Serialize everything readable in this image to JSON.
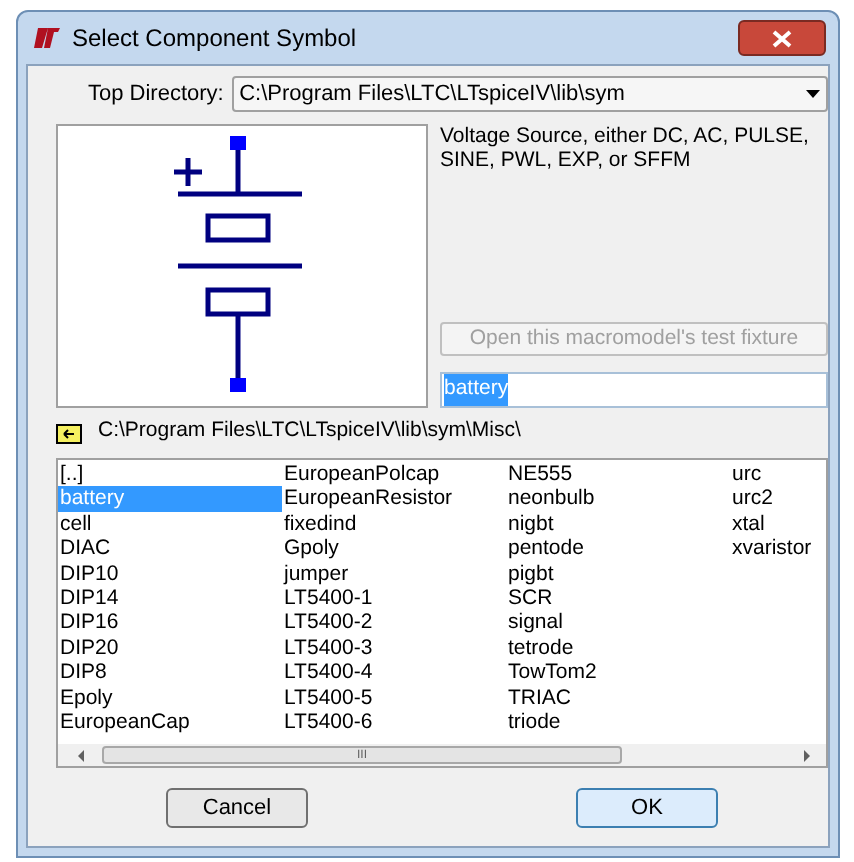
{
  "window": {
    "title": "Select Component Symbol"
  },
  "top_directory": {
    "label": "Top Directory:",
    "value": "C:\\Program Files\\LTC\\LTspiceIV\\lib\\sym"
  },
  "description": "Voltage Source, either DC, AC, PULSE, SINE, PWL, EXP, or SFFM",
  "test_fixture_button": {
    "label": "Open this macromodel's test fixture",
    "disabled": true
  },
  "name_field": {
    "value": "battery",
    "highlighted": true
  },
  "current_path": "C:\\Program Files\\LTC\\LTspiceIV\\lib\\sym\\Misc\\",
  "file_columns": [
    [
      {
        "name": "[..]",
        "selected": false
      },
      {
        "name": "battery",
        "selected": true
      },
      {
        "name": "cell",
        "selected": false
      },
      {
        "name": "DIAC",
        "selected": false
      },
      {
        "name": "DIP10",
        "selected": false
      },
      {
        "name": "DIP14",
        "selected": false
      },
      {
        "name": "DIP16",
        "selected": false
      },
      {
        "name": "DIP20",
        "selected": false
      },
      {
        "name": "DIP8",
        "selected": false
      },
      {
        "name": "Epoly",
        "selected": false
      },
      {
        "name": "EuropeanCap",
        "selected": false
      }
    ],
    [
      {
        "name": "EuropeanPolcap",
        "selected": false
      },
      {
        "name": "EuropeanResistor",
        "selected": false
      },
      {
        "name": "fixedind",
        "selected": false
      },
      {
        "name": "Gpoly",
        "selected": false
      },
      {
        "name": "jumper",
        "selected": false
      },
      {
        "name": "LT5400-1",
        "selected": false
      },
      {
        "name": "LT5400-2",
        "selected": false
      },
      {
        "name": "LT5400-3",
        "selected": false
      },
      {
        "name": "LT5400-4",
        "selected": false
      },
      {
        "name": "LT5400-5",
        "selected": false
      },
      {
        "name": "LT5400-6",
        "selected": false
      }
    ],
    [
      {
        "name": "NE555",
        "selected": false
      },
      {
        "name": "neonbulb",
        "selected": false
      },
      {
        "name": "nigbt",
        "selected": false
      },
      {
        "name": "pentode",
        "selected": false
      },
      {
        "name": "pigbt",
        "selected": false
      },
      {
        "name": "SCR",
        "selected": false
      },
      {
        "name": "signal",
        "selected": false
      },
      {
        "name": "tetrode",
        "selected": false
      },
      {
        "name": "TowTom2",
        "selected": false
      },
      {
        "name": "TRIAC",
        "selected": false
      },
      {
        "name": "triode",
        "selected": false
      }
    ],
    [
      {
        "name": "urc",
        "selected": false
      },
      {
        "name": "urc2",
        "selected": false
      },
      {
        "name": "xtal",
        "selected": false
      },
      {
        "name": "xvaristor",
        "selected": false
      }
    ]
  ],
  "scrollbar_thumb": "III",
  "buttons": [
    {
      "label": "Cancel",
      "default": false
    },
    {
      "label": "OK",
      "default": true
    }
  ]
}
